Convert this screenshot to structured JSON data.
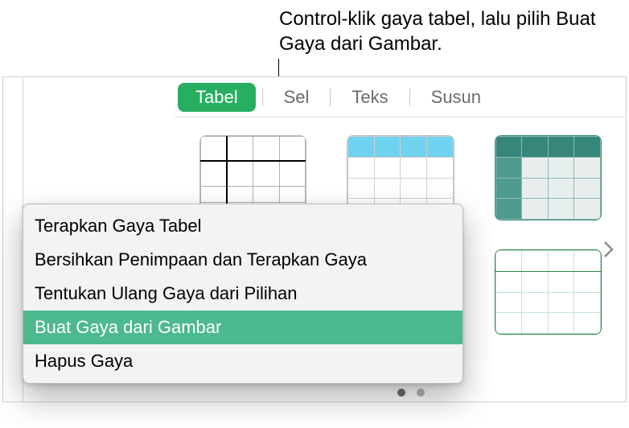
{
  "callout": {
    "text": "Control-klik gaya tabel, lalu pilih Buat Gaya dari Gambar."
  },
  "tabs": {
    "tabel": "Tabel",
    "sel": "Sel",
    "teks": "Teks",
    "susun": "Susun"
  },
  "context_menu": {
    "items": [
      "Terapkan Gaya Tabel",
      "Bersihkan Penimpaan dan Terapkan Gaya",
      "Tentukan Ulang Gaya dari Pilihan",
      "Buat Gaya dari Gambar",
      "Hapus Gaya"
    ],
    "highlighted_index": 3
  },
  "pager": {
    "count": 2,
    "active_index": 0
  }
}
